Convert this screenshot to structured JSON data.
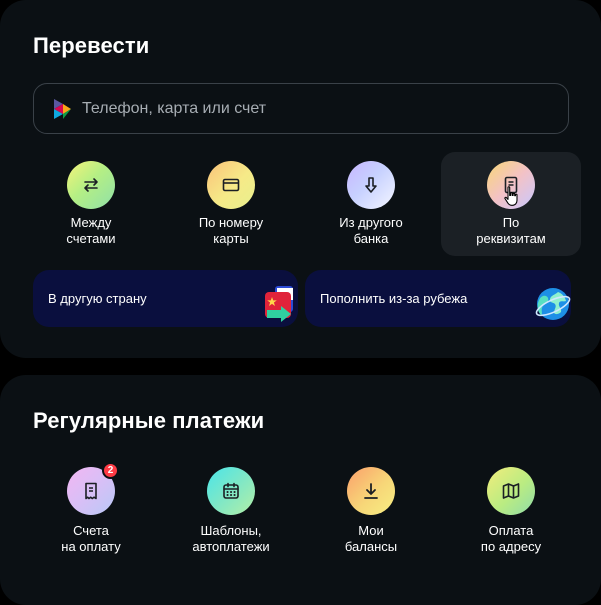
{
  "transfer": {
    "title": "Перевести",
    "search": {
      "placeholder": "Телефон, карта или счет"
    },
    "actions": [
      {
        "line1": "Между",
        "line2": "счетами",
        "icon": "arrows-swap-icon"
      },
      {
        "line1": "По номеру",
        "line2": "карты",
        "icon": "card-icon"
      },
      {
        "line1": "Из другого",
        "line2": "банка",
        "icon": "arrow-down-icon"
      },
      {
        "line1": "По",
        "line2": "реквизитам",
        "icon": "document-icon"
      }
    ],
    "banners": [
      {
        "label": "В другую страну",
        "icon": "flags-icon"
      },
      {
        "label": "Пополнить из-за рубежа",
        "icon": "globe-icon"
      }
    ]
  },
  "regular": {
    "title": "Регулярные платежи",
    "actions": [
      {
        "line1": "Счета",
        "line2": "на оплату",
        "icon": "receipt-icon",
        "badge": "2"
      },
      {
        "line1": "Шаблоны,",
        "line2": "автоплатежи",
        "icon": "calendar-icon"
      },
      {
        "line1": "Мои",
        "line2": "балансы",
        "icon": "download-icon"
      },
      {
        "line1": "Оплата",
        "line2": "по адресу",
        "icon": "map-icon"
      }
    ]
  },
  "colors": {
    "background": "#000000",
    "card": "#0b1014",
    "active_tile": "#1b2025",
    "banner": "#0a0f3e",
    "badge": "#ff3b45"
  }
}
